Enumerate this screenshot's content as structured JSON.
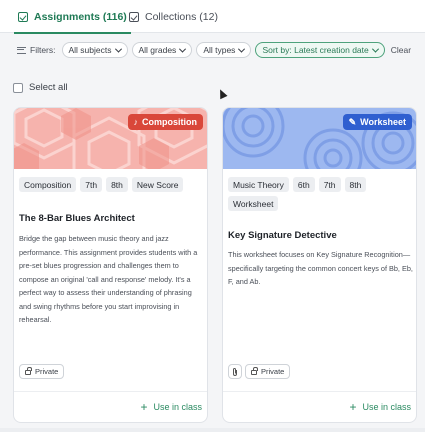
{
  "tabs": [
    {
      "label": "Assignments (116)",
      "icon": "check-square-icon",
      "active": true
    },
    {
      "label": "Collections (12)",
      "icon": "folder-icon",
      "active": false
    }
  ],
  "filters": {
    "label": "Filters:",
    "subjects": "All subjects",
    "grades": "All grades",
    "types": "All types",
    "sort": "Sort by: Latest creation date",
    "clear": "Clear"
  },
  "select_all": "Select all",
  "cards": [
    {
      "badge": "Composition",
      "badge_icon": "music-note-icon",
      "tags": [
        "Composition",
        "7th",
        "8th",
        "New Score"
      ],
      "title": "The 8-Bar Blues Architect",
      "description": "Bridge the gap between music theory and jazz performance. This assignment provides students with a pre-set blues progression and challenges them to compose an original 'call and response' melody. It's a perfect way to assess their understanding of phrasing and swing rhythms before you start improvising in rehearsal.",
      "visibility": "Private",
      "action": "Use in class",
      "accent": "#d9473a"
    },
    {
      "badge": "Worksheet",
      "badge_icon": "edit-icon",
      "tags": [
        "Music Theory",
        "6th",
        "7th",
        "8th",
        "Worksheet"
      ],
      "title": "Key Signature Detective",
      "description": "This worksheet focuses on Key Signature Recognition—specifically targeting the common concert keys of Bb, Eb, F, and Ab.",
      "visibility": "Private",
      "action": "Use in class",
      "accent": "#2f5fd0"
    }
  ]
}
